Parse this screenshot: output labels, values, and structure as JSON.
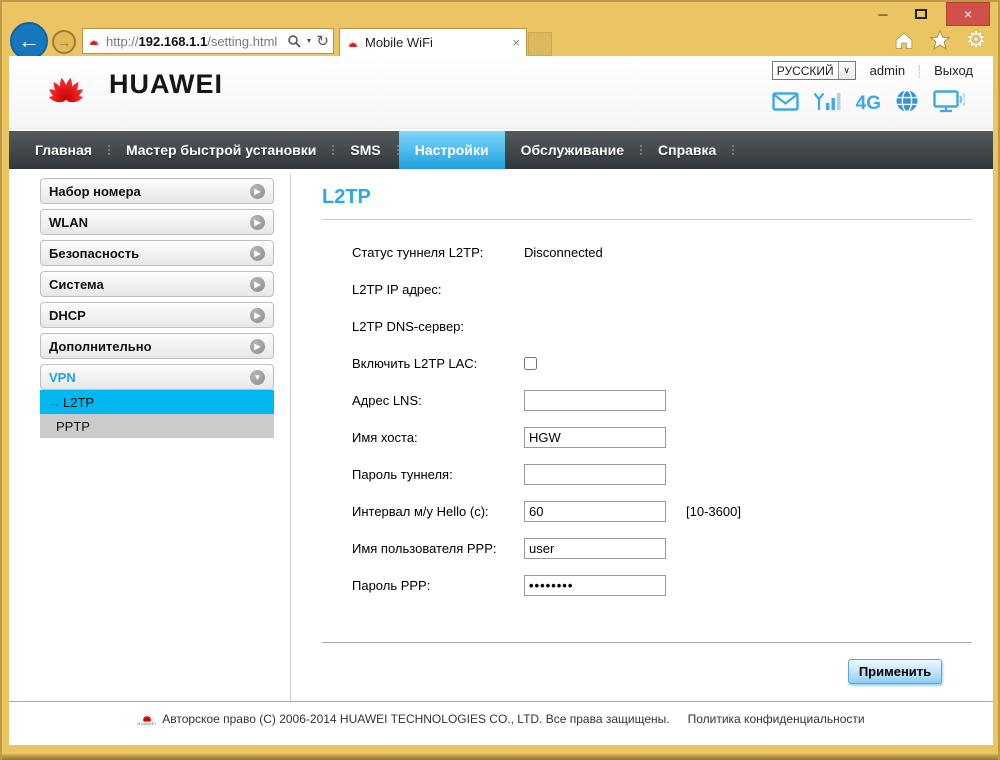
{
  "browser": {
    "url_prefix": "http://",
    "url_host": "192.168.1.1",
    "url_path": "/setting.html",
    "tab_title": "Mobile WiFi",
    "close_glyph": "×",
    "back_glyph": "←",
    "forward_glyph": "→",
    "refresh_glyph": "↻",
    "caret_glyph": "▼",
    "minimize_glyph": "─"
  },
  "header": {
    "brand": "HUAWEI",
    "language_selected": "РУССКИЙ",
    "language_caret": "∨",
    "user": "admin",
    "logout": "Выход",
    "network_mode": "4G"
  },
  "nav": {
    "items": [
      {
        "label": "Главная",
        "active": false
      },
      {
        "label": "Мастер быстрой установки",
        "active": false
      },
      {
        "label": "SMS",
        "active": false
      },
      {
        "label": "Настройки",
        "active": true
      },
      {
        "label": "Обслуживание",
        "active": false
      },
      {
        "label": "Справка",
        "active": false
      }
    ]
  },
  "sidebar": {
    "items": [
      {
        "label": "Набор номера",
        "state": "collapsed"
      },
      {
        "label": "WLAN",
        "state": "collapsed"
      },
      {
        "label": "Безопасность",
        "state": "collapsed"
      },
      {
        "label": "Система",
        "state": "collapsed"
      },
      {
        "label": "DHCP",
        "state": "collapsed"
      },
      {
        "label": "Дополнительно",
        "state": "collapsed"
      },
      {
        "label": "VPN",
        "state": "expanded"
      }
    ],
    "collapsed_glyph": "▶",
    "expanded_glyph": "▼",
    "subitems": [
      {
        "label": "L2TP",
        "active": true,
        "marker": "→"
      },
      {
        "label": "PPTP",
        "active": false,
        "marker": ""
      }
    ]
  },
  "main": {
    "title": "L2TP",
    "rows": [
      {
        "label": "Статус туннеля L2TP:",
        "value": "Disconnected",
        "type": "static"
      },
      {
        "label": "L2TP IP адрес:",
        "value": "",
        "type": "static"
      },
      {
        "label": "L2TP DNS-сервер:",
        "value": "",
        "type": "static"
      },
      {
        "label": "Включить L2TP LAC:",
        "checked": false,
        "type": "checkbox"
      },
      {
        "label": "Адрес LNS:",
        "value": "",
        "type": "input"
      },
      {
        "label": "Имя хоста:",
        "value": "HGW",
        "type": "input"
      },
      {
        "label": "Пароль туннеля:",
        "value": "",
        "type": "input"
      },
      {
        "label": "Интервал м/у Hello (с):",
        "value": "60",
        "hint": "[10-3600]",
        "type": "input"
      },
      {
        "label": "Имя пользователя PPP:",
        "value": "user",
        "type": "input"
      },
      {
        "label": "Пароль PPP:",
        "value": "••••••••",
        "type": "password"
      }
    ],
    "apply_label": "Применить"
  },
  "footer": {
    "copyright": "Авторское право (C) 2006-2014 HUAWEI TECHNOLOGIES CO., LTD. Все права защищены.",
    "privacy": "Политика конфиденциальности"
  },
  "colors": {
    "chrome_gold": "#ebc463",
    "accent_blue": "#29abe2",
    "active_cyan": "#00b7f0",
    "nav_dark": "#43484c",
    "huawei_red": "#e2001a",
    "close_red": "#cf5149"
  }
}
